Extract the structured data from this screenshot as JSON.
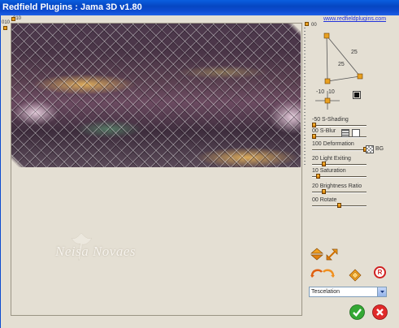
{
  "window": {
    "title": "Redfield Plugins : Jama 3D  v1.80"
  },
  "link": {
    "text": "www.redfieldplugins.com"
  },
  "rulers": {
    "horizontal_label": "010",
    "vertical_label": "010",
    "vertical_label_short": "00"
  },
  "light": {
    "upper_value": "25",
    "lower_value": "25",
    "x_value": "-10",
    "y_value": "10",
    "swatch_color": "#111111"
  },
  "sliders": [
    {
      "label": "-50  S-Shading",
      "value": "-50",
      "name": "S-Shading",
      "level": 0.05
    },
    {
      "label": "00  S-Blur",
      "value": "00",
      "name": "S-Blur",
      "level": 0.02
    },
    {
      "label": "100  Deformation",
      "value": "100",
      "name": "Deformation",
      "level": 0.98
    },
    {
      "label": "20  Light Exiting",
      "value": "20",
      "name": "Light Exiting",
      "level": 0.2
    },
    {
      "label": "10  Saturation",
      "value": "10",
      "name": "Saturation",
      "level": 0.1
    },
    {
      "label": "20  Brightness Ratio",
      "value": "20",
      "name": "Brightness Ratio",
      "level": 0.2
    },
    {
      "label": "00  Rotate",
      "value": "00",
      "name": "Rotate",
      "level": 0.5
    }
  ],
  "bg_label": "BG",
  "watermark": "Neisa Novaes",
  "preset": {
    "selected": "Tescelation"
  },
  "colors": {
    "title_bar": "#0646c2",
    "ok": "#2fa02f",
    "cancel": "#e02a2a",
    "accent": "#e8a020"
  }
}
